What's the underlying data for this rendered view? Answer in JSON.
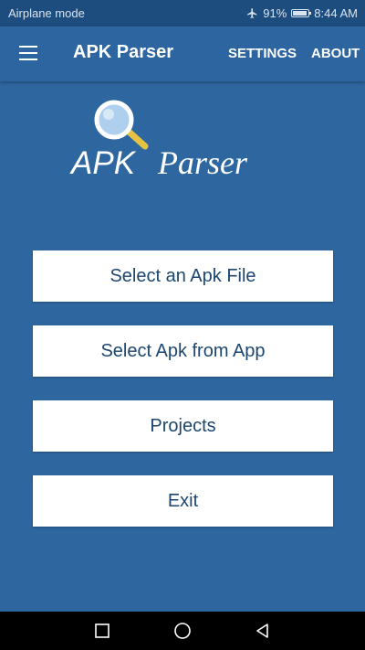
{
  "status_bar": {
    "left_text": "Airplane mode",
    "battery": "91%",
    "time": "8:44 AM",
    "icons": [
      "airplane-icon",
      "battery-icon"
    ]
  },
  "app_bar": {
    "title": "APK Parser",
    "actions": [
      "SETTINGS",
      "ABOUT"
    ],
    "menu_icon": "hamburger-menu-icon"
  },
  "logo": {
    "text_apk": "APK",
    "text_parser": "Parser",
    "icon": "magnifying-glass-icon"
  },
  "buttons": [
    "Select an Apk File",
    "Select Apk from App",
    "Projects",
    "Exit"
  ],
  "nav_bar": {
    "icons": [
      "recents-icon",
      "home-icon",
      "back-icon"
    ]
  },
  "colors": {
    "background": "#2e66a0",
    "status_bar": "#1d4d7e",
    "app_bar": "#2d65a0",
    "button_background": "#ffffff",
    "button_text": "#1c466f",
    "magnifier_handle": "#e6c243"
  }
}
